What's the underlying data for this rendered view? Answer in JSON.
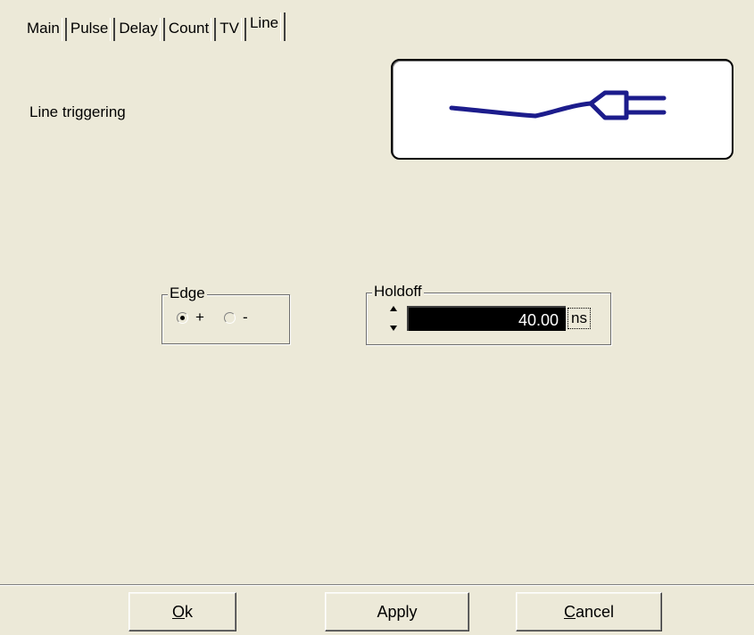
{
  "tabs": [
    {
      "label": "Main"
    },
    {
      "label": "Pulse"
    },
    {
      "label": "Delay"
    },
    {
      "label": "Count"
    },
    {
      "label": "TV"
    },
    {
      "label": "Line",
      "active": true
    }
  ],
  "page_title": "Line triggering",
  "image": {
    "icon": "power-plug-icon",
    "color": "#1c1c8c"
  },
  "edge": {
    "legend": "Edge",
    "options": [
      {
        "label": "+",
        "selected": true
      },
      {
        "label": "-",
        "selected": false
      }
    ]
  },
  "holdoff": {
    "legend": "Holdoff",
    "value": "40.00",
    "unit": "ns"
  },
  "buttons": {
    "ok": {
      "mnemonic": "O",
      "rest": "k"
    },
    "apply": "Apply",
    "cancel": {
      "mnemonic": "C",
      "rest": "ancel"
    }
  }
}
